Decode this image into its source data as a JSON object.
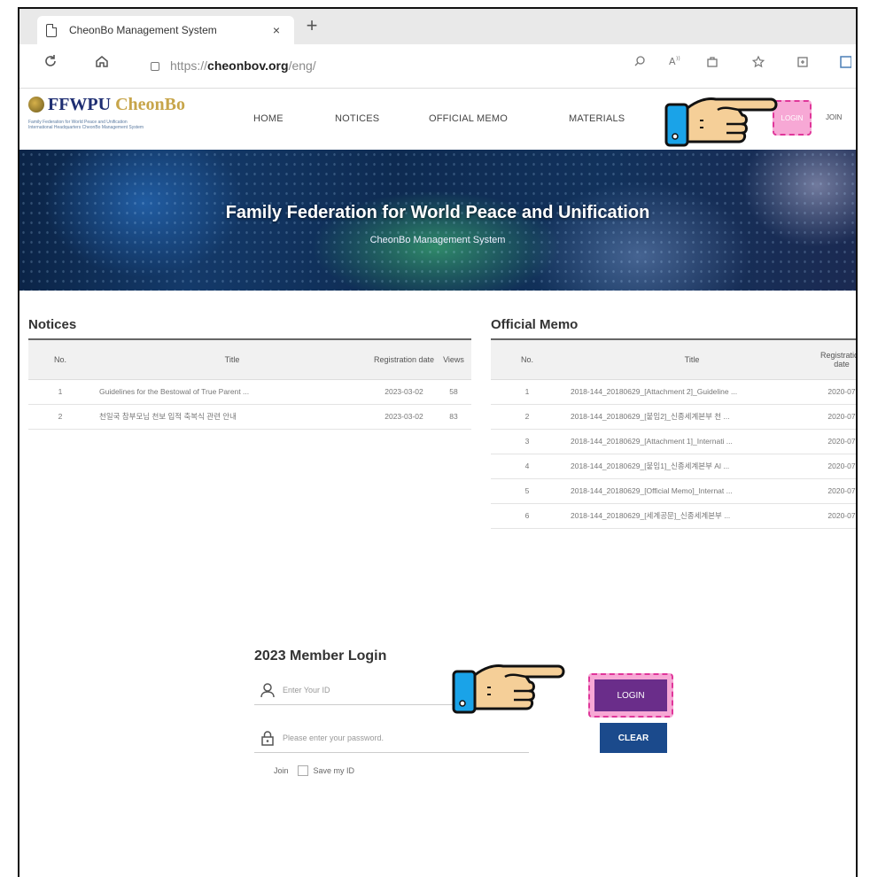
{
  "browser": {
    "tab_title": "CheonBo Management System",
    "tab_close": "×",
    "new_tab": "+",
    "url_prefix": "https://",
    "url_domain": "cheonbov.org",
    "url_path": "/eng/"
  },
  "site": {
    "logo_main": "FFWPU",
    "logo_accent": "CheonBo",
    "logo_sub_line1": "Family Federation for World Peace and Unification",
    "logo_sub_line2": "International Headquarters CheonBo Management System",
    "nav": {
      "home": "HOME",
      "notices": "NOTICES",
      "official_memo": "OFFICIAL MEMO",
      "materials": "MATERIALS"
    },
    "login_link": "LOGIN",
    "join_link": "JOIN"
  },
  "banner": {
    "title": "Family Federation for World Peace and Unification",
    "subtitle": "CheonBo Management System"
  },
  "notices": {
    "title": "Notices",
    "columns": {
      "no": "No.",
      "title": "Title",
      "reg_date": "Registration date",
      "views": "Views"
    },
    "rows": [
      {
        "no": "1",
        "title": "Guidelines for the Bestowal of True Parent ...",
        "date": "2023-03-02",
        "views": "58"
      },
      {
        "no": "2",
        "title": "천일국 참부모님 천보 입적 축복식 관련 안내",
        "date": "2023-03-02",
        "views": "83"
      }
    ]
  },
  "memo": {
    "title": "Official Memo",
    "columns": {
      "no": "No.",
      "title": "Title",
      "reg_date": "Registration date"
    },
    "rows": [
      {
        "no": "1",
        "title": "2018-144_20180629_[Attachment 2]_Guideline ...",
        "date": "2020-07"
      },
      {
        "no": "2",
        "title": "2018-144_20180629_[붙임2]_신종세계본부 천 ...",
        "date": "2020-07"
      },
      {
        "no": "3",
        "title": "2018-144_20180629_[Attachment 1]_Internati ...",
        "date": "2020-07"
      },
      {
        "no": "4",
        "title": "2018-144_20180629_[붙임1]_신종세계본부 Al ...",
        "date": "2020-07"
      },
      {
        "no": "5",
        "title": "2018-144_20180629_[Official Memo]_Internat ...",
        "date": "2020-07"
      },
      {
        "no": "6",
        "title": "2018-144_20180629_[세계공문]_신종세계본부 ...",
        "date": "2020-07"
      }
    ]
  },
  "login": {
    "title": "2023 Member Login",
    "id_placeholder": "Enter Your ID",
    "pw_placeholder": "Please enter your password.",
    "login_button": "LOGIN",
    "clear_button": "CLEAR",
    "join_label": "Join",
    "save_id_label": "Save my ID"
  },
  "colors": {
    "highlight_fill": "#f7a8d5",
    "highlight_border": "#e0369a",
    "login_button": "#6a2d8a",
    "clear_button": "#1b4a8c",
    "hand_cuff": "#1aa3e8",
    "hand_skin": "#f5cf98"
  }
}
